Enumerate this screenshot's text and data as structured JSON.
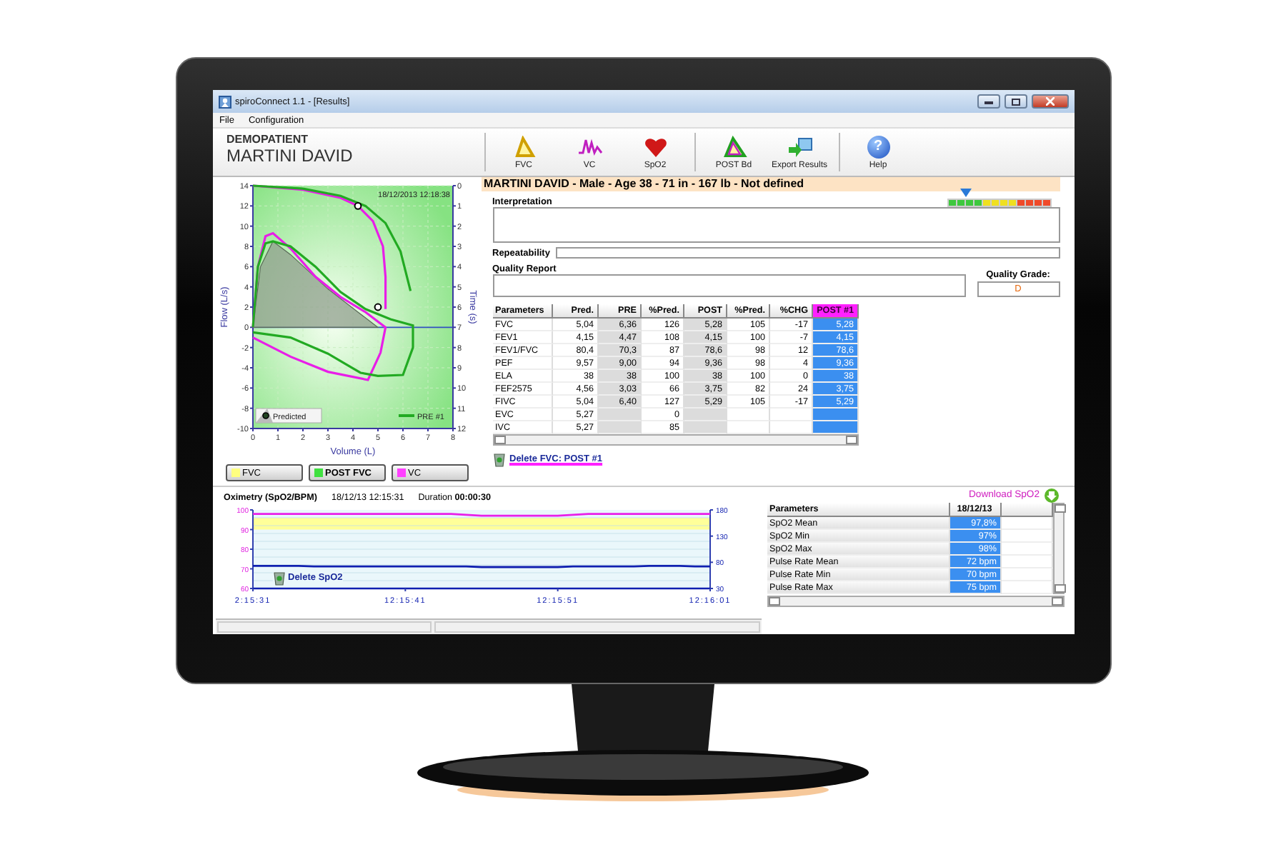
{
  "window": {
    "title": "spiroConnect 1.1 - [Results]"
  },
  "menu": [
    "File",
    "Configuration"
  ],
  "patient": {
    "label": "DEMOPATIENT",
    "name": "MARTINI DAVID"
  },
  "toolbar": [
    {
      "label": "FVC",
      "kind": "fvc"
    },
    {
      "label": "VC",
      "kind": "vc"
    },
    {
      "label": "SpO2",
      "kind": "spo2"
    },
    {
      "label": "POST Bd",
      "kind": "postbd"
    },
    {
      "label": "Export Results",
      "kind": "export"
    },
    {
      "label": "Help",
      "kind": "help",
      "glyph": "?"
    }
  ],
  "spirometry": {
    "timestamp": "18/12/2013 12:18:38",
    "legend": [
      {
        "label": "Predicted",
        "kind": "marker"
      },
      {
        "label": "PRE #1",
        "kind": "line",
        "color": "#22aa22"
      }
    ],
    "chart_data": {
      "type": "line",
      "xlabel": "Volume (L)",
      "ylabel": "Flow (L/s)",
      "y2label": "Time (s)",
      "xlim": [
        0,
        8
      ],
      "ylim": [
        -10,
        14
      ],
      "y2lim": [
        12,
        0
      ],
      "xticks": [
        0,
        1,
        2,
        3,
        4,
        5,
        6,
        7,
        8
      ],
      "yticks": [
        -10,
        -8,
        -6,
        -4,
        -2,
        0,
        2,
        4,
        6,
        8,
        10,
        12,
        14
      ],
      "y2ticks": [
        0,
        1,
        2,
        3,
        4,
        5,
        6,
        7,
        8,
        9,
        10,
        11,
        12
      ],
      "series": [
        {
          "type": "area",
          "color": "#8f9f8c",
          "x": [
            0,
            0.3,
            0.8,
            1.5,
            3,
            4.2,
            5
          ],
          "values": [
            0,
            6,
            8.5,
            7.2,
            3.8,
            1.5,
            0
          ]
        },
        {
          "type": "line",
          "color": "#e81ee8",
          "x": [
            0,
            0.2,
            0.5,
            0.8,
            1.5,
            2.5,
            3.5,
            4.5,
            5.3,
            5.1,
            4.6,
            3,
            1.5,
            0
          ],
          "values": [
            0,
            6,
            9,
            9.3,
            7.8,
            5,
            3,
            1.5,
            0,
            -2.5,
            -5.2,
            -4.4,
            -2.9,
            -1
          ]
        },
        {
          "type": "line",
          "color": "#22aa22",
          "x": [
            0,
            0.2,
            0.5,
            0.8,
            1.5,
            2.5,
            3.5,
            4.5,
            5.5,
            6.4,
            6.4,
            6,
            5,
            4.3,
            3,
            1.5,
            0
          ],
          "values": [
            0,
            6,
            8.3,
            8.5,
            8,
            6,
            3.5,
            1.8,
            0.8,
            0.2,
            -2,
            -4.7,
            -4.8,
            -4.5,
            -2.6,
            -1,
            -0.5
          ]
        },
        {
          "type": "line",
          "color": "#e81ee8",
          "x": [
            0,
            2,
            3.5,
            4.2,
            4.8,
            5.2,
            5.3,
            5.3
          ],
          "values": [
            14,
            13.6,
            12.8,
            12,
            10.5,
            8,
            5,
            1.8
          ]
        },
        {
          "type": "line",
          "color": "#22aa22",
          "x": [
            0,
            2,
            3.5,
            4.5,
            5.3,
            5.9,
            6.3
          ],
          "values": [
            14,
            13.7,
            13,
            12,
            10.3,
            7.5,
            3.6
          ]
        },
        {
          "type": "scatter",
          "color": "#ffffff",
          "x": [
            4.2,
            5
          ],
          "values": [
            12,
            2
          ]
        }
      ],
      "grid": true,
      "ref_lines": [
        {
          "axis": "y",
          "value": 0,
          "color": "#3050c0"
        }
      ]
    }
  },
  "curve_buttons": [
    {
      "label": "FVC",
      "color": "#ffff80",
      "selected": false
    },
    {
      "label": "POST FVC",
      "color": "#40e040",
      "selected": true
    },
    {
      "label": "VC",
      "color": "#ff40ff",
      "selected": false
    }
  ],
  "summary": "MARTINI DAVID - Male - Age 38 - 71 in - 167 lb - Not defined",
  "interpretation": {
    "label": "Interpretation",
    "level": 0.18
  },
  "repeatability": {
    "label": "Repeatability"
  },
  "quality": {
    "label": "Quality Report",
    "grade_label": "Quality Grade:",
    "grade": "D"
  },
  "results_table": {
    "columns": [
      "Parameters",
      "Pred.",
      "PRE",
      "%Pred.",
      "POST",
      "%Pred.",
      "%CHG",
      "POST #1"
    ],
    "rows": [
      [
        "FVC",
        "5,04",
        "6,36",
        "126",
        "5,28",
        "105",
        "-17",
        "5,28"
      ],
      [
        "FEV1",
        "4,15",
        "4,47",
        "108",
        "4,15",
        "100",
        "-7",
        "4,15"
      ],
      [
        "FEV1/FVC",
        "80,4",
        "70,3",
        "87",
        "78,6",
        "98",
        "12",
        "78,6"
      ],
      [
        "PEF",
        "9,57",
        "9,00",
        "94",
        "9,36",
        "98",
        "4",
        "9,36"
      ],
      [
        "ELA",
        "38",
        "38",
        "100",
        "38",
        "100",
        "0",
        "38"
      ],
      [
        "FEF2575",
        "4,56",
        "3,03",
        "66",
        "3,75",
        "82",
        "24",
        "3,75"
      ],
      [
        "FIVC",
        "5,04",
        "6,40",
        "127",
        "5,29",
        "105",
        "-17",
        "5,29"
      ],
      [
        "EVC",
        "5,27",
        null,
        "0",
        null,
        null,
        null,
        null
      ],
      [
        "IVC",
        "5,27",
        null,
        "85",
        null,
        null,
        null,
        null
      ]
    ]
  },
  "delete_link": "Delete FVC: POST #1",
  "download_link": "Download SpO2",
  "oximetry": {
    "title": "Oximetry (SpO2/BPM)",
    "date": "18/12/13 12:15:31",
    "duration": "Duration **00:00:30**",
    "delete_label": "Delete SpO2",
    "chart_data": {
      "type": "line",
      "categories": [
        "2:15:31",
        null,
        null,
        null,
        null,
        null,
        null,
        null,
        null,
        null,
        "12:15:41",
        null,
        null,
        null,
        null,
        null,
        null,
        null,
        null,
        null,
        "12:15:51",
        null,
        null,
        null,
        null,
        null,
        null,
        null,
        null,
        null,
        "12:16:01"
      ],
      "ylim": [
        60,
        100
      ],
      "y2lim": [
        30,
        180
      ],
      "yticks": [
        60,
        70,
        80,
        90,
        100
      ],
      "y2ticks": [
        30,
        80,
        130,
        180
      ],
      "series": [
        {
          "color": "#e81ee8",
          "values": [
            98,
            98,
            98,
            98,
            98,
            98,
            98,
            98,
            98,
            98,
            98,
            98,
            98,
            98,
            97.5,
            97,
            97,
            97,
            97,
            97,
            97,
            97.5,
            98,
            98,
            98,
            98,
            98,
            98,
            98,
            98,
            98
          ]
        },
        {
          "color": "#1020b0",
          "axis": "y2",
          "values": [
            73,
            73,
            73,
            73,
            72,
            72,
            72,
            72,
            72,
            72,
            72,
            72,
            72,
            72,
            72,
            71,
            71,
            71,
            71,
            71,
            71,
            72,
            72,
            72,
            72,
            72,
            73,
            73,
            73,
            72,
            72
          ]
        }
      ],
      "bands": [
        {
          "axis": "y",
          "from": 90,
          "to": 96,
          "color": "#ffff99"
        }
      ]
    }
  },
  "spo2_table": {
    "columns": [
      "Parameters",
      "18/12/13"
    ],
    "rows": [
      [
        "SpO2 Mean",
        "97,8%"
      ],
      [
        "SpO2 Min",
        "97%"
      ],
      [
        "SpO2 Max",
        "98%"
      ],
      [
        "Pulse Rate Mean",
        "72 bpm"
      ],
      [
        "Pulse Rate Min",
        "70 bpm"
      ],
      [
        "Pulse Rate Max",
        "75 bpm"
      ]
    ]
  }
}
